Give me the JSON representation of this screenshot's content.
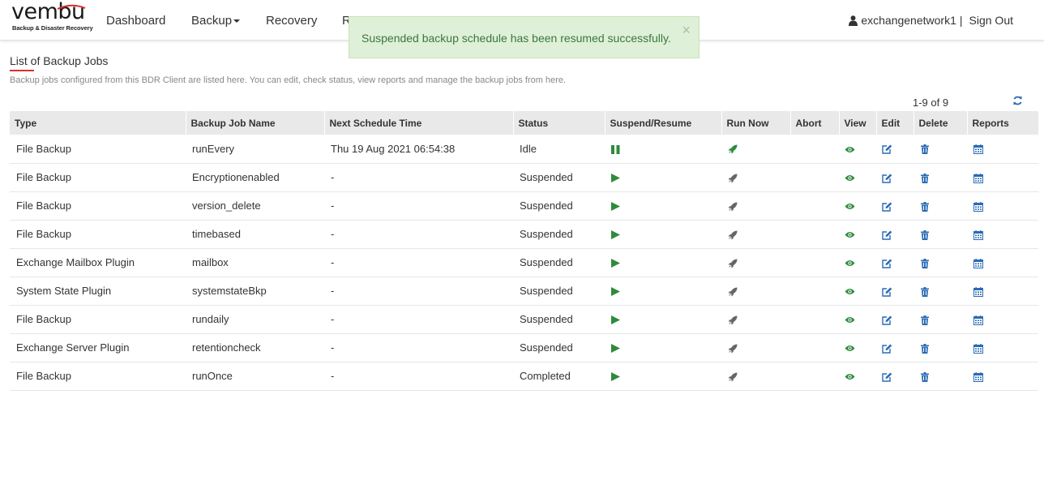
{
  "brand": {
    "name": "vembu",
    "tagline": "Backup & Disaster Recovery"
  },
  "nav": {
    "dashboard": "Dashboard",
    "backup": "Backup",
    "recovery": "Recovery",
    "reports_partial": "R"
  },
  "user": {
    "name": "exchangenetwork1",
    "separator": "|",
    "sign_out": "Sign Out"
  },
  "alert": {
    "message": "Suspended backup schedule has been resumed successfully.",
    "close": "×"
  },
  "page": {
    "title": "List of Backup Jobs",
    "description": "Backup jobs configured from this BDR Client are listed here. You can edit, check status, view reports and manage the backup jobs from here.",
    "pagination": "1-9 of 9"
  },
  "table": {
    "headers": [
      "Type",
      "Backup Job Name",
      "Next Schedule Time",
      "Status",
      "Suspend/Resume",
      "Run Now",
      "Abort",
      "View",
      "Edit",
      "Delete",
      "Reports"
    ],
    "rows": [
      {
        "type": "File Backup",
        "name": "runEvery",
        "next": "Thu 19 Aug 2021 06:54:38",
        "status": "Idle",
        "suspend_icon": "pause-icon",
        "run_active": true
      },
      {
        "type": "File Backup",
        "name": "Encryptionenabled",
        "next": "-",
        "status": "Suspended",
        "suspend_icon": "play-icon",
        "run_active": false
      },
      {
        "type": "File Backup",
        "name": "version_delete",
        "next": "-",
        "status": "Suspended",
        "suspend_icon": "play-icon",
        "run_active": false
      },
      {
        "type": "File Backup",
        "name": "timebased",
        "next": "-",
        "status": "Suspended",
        "suspend_icon": "play-icon",
        "run_active": false
      },
      {
        "type": "Exchange Mailbox Plugin",
        "name": "mailbox",
        "next": "-",
        "status": "Suspended",
        "suspend_icon": "play-icon",
        "run_active": false
      },
      {
        "type": "System State Plugin",
        "name": "systemstateBkp",
        "next": "-",
        "status": "Suspended",
        "suspend_icon": "play-icon",
        "run_active": false
      },
      {
        "type": "File Backup",
        "name": "rundaily",
        "next": "-",
        "status": "Suspended",
        "suspend_icon": "play-icon",
        "run_active": false
      },
      {
        "type": "Exchange Server Plugin",
        "name": "retentioncheck",
        "next": "-",
        "status": "Suspended",
        "suspend_icon": "play-icon",
        "run_active": false
      },
      {
        "type": "File Backup",
        "name": "runOnce",
        "next": "-",
        "status": "Completed",
        "suspend_icon": "play-icon",
        "run_active": false
      }
    ]
  },
  "colors": {
    "accent_red": "#d9302c",
    "green": "#2e8b3d",
    "rocket_inactive": "#666666",
    "blue": "#2a6bb5",
    "alert_bg": "#dff0d8",
    "alert_text": "#3c763d"
  }
}
